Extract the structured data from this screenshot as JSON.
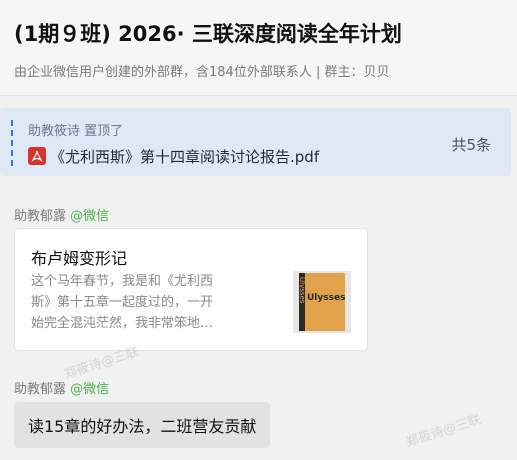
{
  "header": {
    "title": "(1期９班) 2026· 三联深度阅读全年计划",
    "subtitle": "由企业微信用户创建的外部群，含184位外部联系人 | 群主：贝贝"
  },
  "pinned": {
    "author": "助教筱诗 置顶了",
    "file_name": "《尤利西斯》第十四章阅读讨论报告.pdf",
    "file_icon": "pdf-icon",
    "count": "共5条"
  },
  "messages": [
    {
      "sender": "助教郁露",
      "sender_tag": "@微信",
      "card": {
        "title": "布卢姆变形记",
        "desc_lines": [
          "这个马年春节，我是和《尤利西",
          "斯》第十五章一起度过的，一开",
          "始完全混沌茫然，我非常笨地…"
        ],
        "thumb_text": "Ulysses"
      }
    },
    {
      "sender": "助教郁露",
      "sender_tag": "@微信",
      "text": "读15章的好办法，二班营友贡献"
    }
  ],
  "watermark": "郑筱诗@三联",
  "colors": {
    "pinned_bg": "#dfe9f6",
    "wechat_green": "#4cb050",
    "pdf_red": "#d9342b"
  }
}
